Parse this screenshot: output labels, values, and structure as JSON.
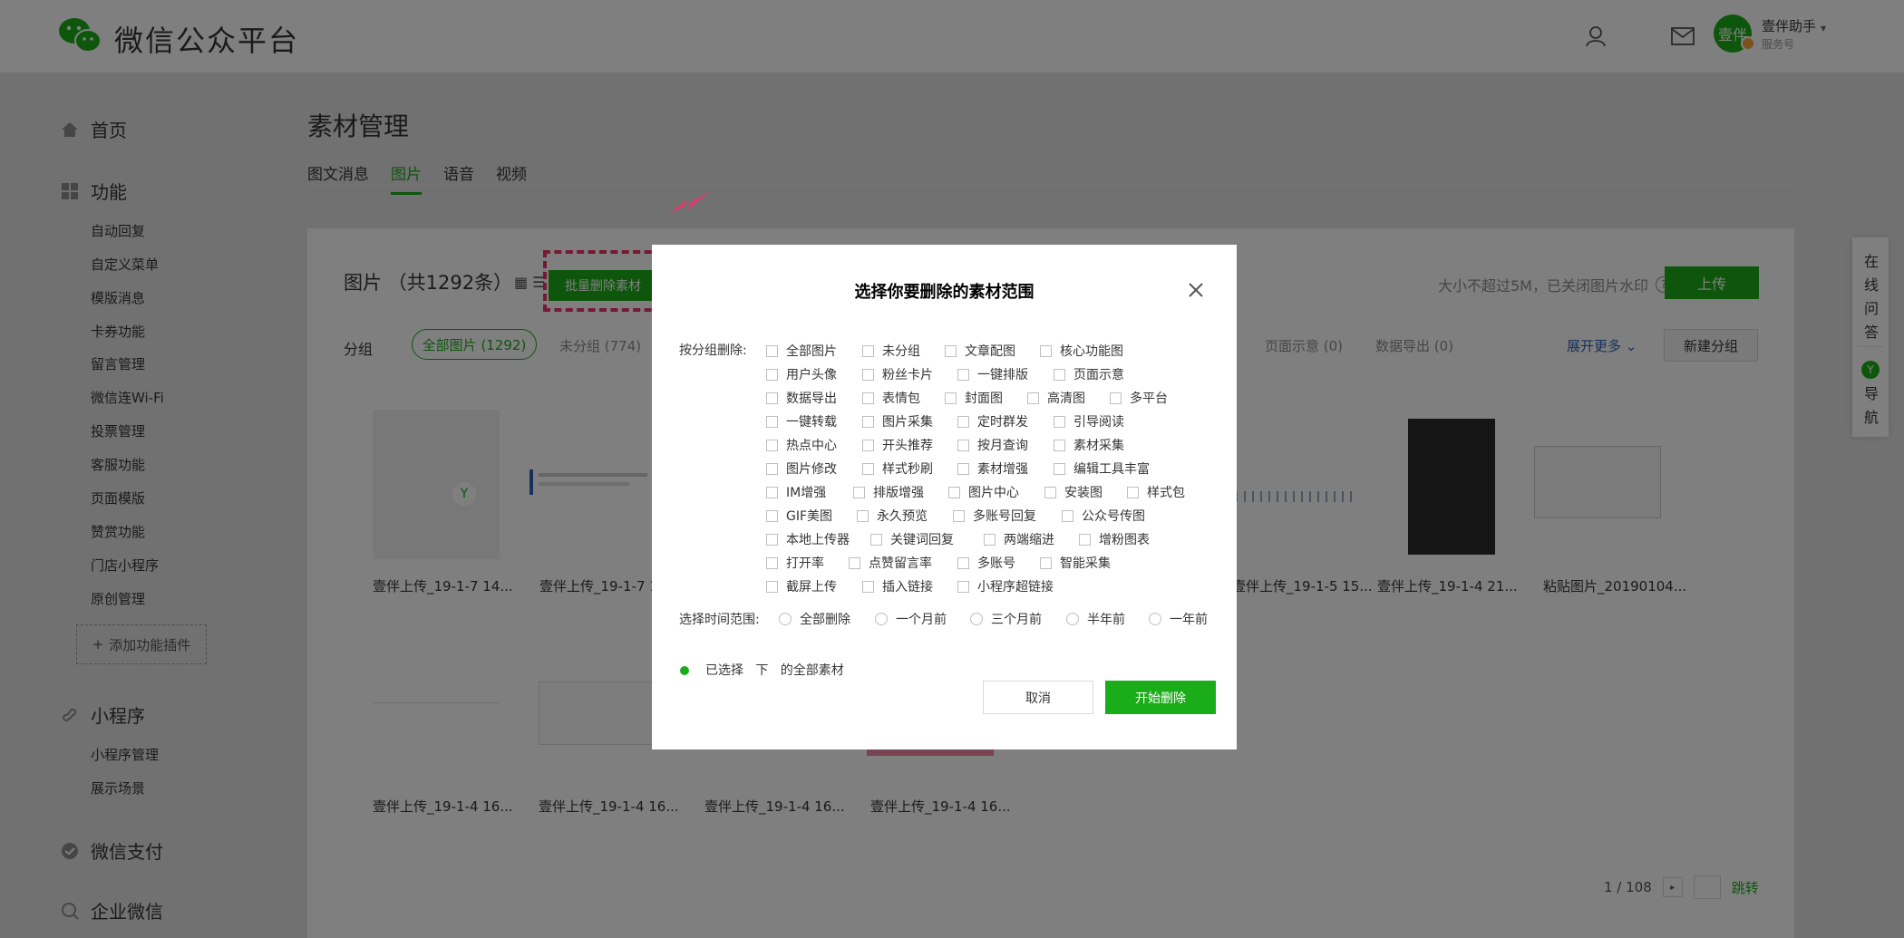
{
  "header": {
    "logo_text": "微信公众平台",
    "account_avatar_text": "壹伴",
    "account_name": "壹伴助手",
    "account_type": "服务号"
  },
  "sidebar": {
    "home": "首页",
    "features": "功能",
    "feature_items": [
      "自动回复",
      "自定义菜单",
      "模版消息",
      "卡券功能",
      "留言管理",
      "微信连Wi-Fi",
      "投票管理",
      "客服功能",
      "页面模版",
      "赞赏功能",
      "门店小程序",
      "原创管理"
    ],
    "add_plugin": "添加功能插件",
    "miniprogram": "小程序",
    "miniprogram_items": [
      "小程序管理",
      "展示场景"
    ],
    "pay": "微信支付",
    "work": "企业微信"
  },
  "main": {
    "title": "素材管理",
    "tabs": [
      "图文消息",
      "图片",
      "语音",
      "视频"
    ],
    "active_tab": "图片",
    "panel_title": "图片 （共1292条）",
    "batch_delete": "批量删除素材",
    "hint": "大小不超过5M，已关闭图片水印",
    "upload": "上传",
    "group_label": "分组",
    "group_all": "全部图片 (1292)",
    "group_items": [
      "未分组 (774)",
      "页面示意 (0)",
      "数据导出 (0)"
    ],
    "expand_more": "展开更多",
    "new_group": "新建分组",
    "thumb_captions_row1": [
      "壹伴上传_19-1-7 14...",
      "壹伴上传_19-1-7 1",
      "壹伴上传_19-1-5 15...",
      "壹伴上传_19-1-4 21...",
      "粘贴图片_20190104..."
    ],
    "thumb_captions_row2": [
      "壹伴上传_19-1-4 16...",
      "壹伴上传_19-1-4 16...",
      "壹伴上传_19-1-4 16...",
      "壹伴上传_19-1-4 16..."
    ],
    "pager_text": "1 / 108",
    "pager_go": "跳转"
  },
  "side_float": {
    "qa": "在线问答",
    "nav": "导航"
  },
  "dialog": {
    "title": "选择你要删除的素材范围",
    "group_label": "按分组删除:",
    "group_rows": [
      [
        "全部图片",
        "未分组",
        "文章配图",
        "核心功能图"
      ],
      [
        "用户头像",
        "粉丝卡片",
        "一键排版",
        "页面示意"
      ],
      [
        "数据导出",
        "表情包",
        "封面图",
        "高清图",
        "多平台"
      ],
      [
        "一键转载",
        "图片采集",
        "定时群发",
        "引导阅读"
      ],
      [
        "热点中心",
        "开头推荐",
        "按月查询",
        "素材采集"
      ],
      [
        "图片修改",
        "样式秒刷",
        "素材增强",
        "编辑工具丰富"
      ],
      [
        "IM增强",
        "排版增强",
        "图片中心",
        "安装图",
        "样式包"
      ],
      [
        "GIF美图",
        "永久预览",
        "多账号回复",
        "公众号传图"
      ],
      [
        "本地上传器",
        "关键词回复",
        "两端缩进",
        "增粉图表"
      ],
      [
        "打开率",
        "点赞留言率",
        "多账号",
        "智能采集"
      ],
      [
        "截屏上传",
        "插入链接",
        "小程序超链接"
      ]
    ],
    "time_label": "选择时间范围:",
    "time_options": [
      "全部删除",
      "一个月前",
      "三个月前",
      "半年前",
      "一年前"
    ],
    "selected_text": "已选择   下   的全部素材",
    "cancel": "取消",
    "start": "开始删除"
  },
  "colors": {
    "brand_green": "#1aad19",
    "highlight_pink": "#e8356b",
    "link_blue": "#2d64b3"
  }
}
